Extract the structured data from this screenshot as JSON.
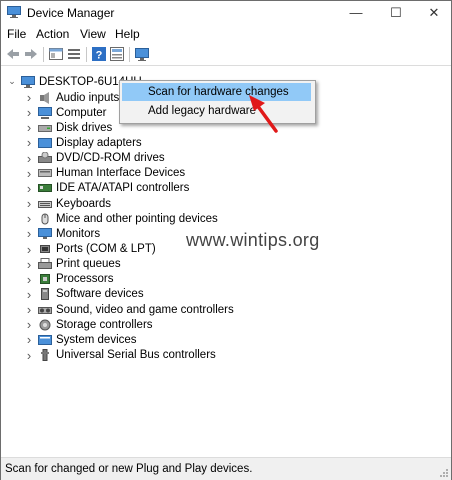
{
  "window": {
    "title": "Device Manager",
    "controls": {
      "minimize": "—",
      "maximize": "☐",
      "close": "✕"
    }
  },
  "menu": [
    "File",
    "Action",
    "View",
    "Help"
  ],
  "toolbar_icons": [
    "back-arrow-icon",
    "forward-arrow-icon",
    "properties-pane-icon",
    "details-icon",
    "help-icon",
    "view-icon",
    "monitor-icon"
  ],
  "tree": {
    "root": "DESKTOP-6U14HU",
    "items": [
      "Audio inputs a",
      "Computer",
      "Disk drives",
      "Display adapters",
      "DVD/CD-ROM drives",
      "Human Interface Devices",
      "IDE ATA/ATAPI controllers",
      "Keyboards",
      "Mice and other pointing devices",
      "Monitors",
      "Ports (COM & LPT)",
      "Print queues",
      "Processors",
      "Software devices",
      "Sound, video and game controllers",
      "Storage controllers",
      "System devices",
      "Universal Serial Bus controllers"
    ]
  },
  "context_menu": {
    "items": [
      "Scan for hardware changes",
      "Add legacy hardware"
    ],
    "highlighted": 0
  },
  "watermark": "www.wintips.org",
  "status": "Scan for changed or new Plug and Play devices.",
  "colors": {
    "highlight": "#91c9f7",
    "arrow": "#e01919"
  }
}
